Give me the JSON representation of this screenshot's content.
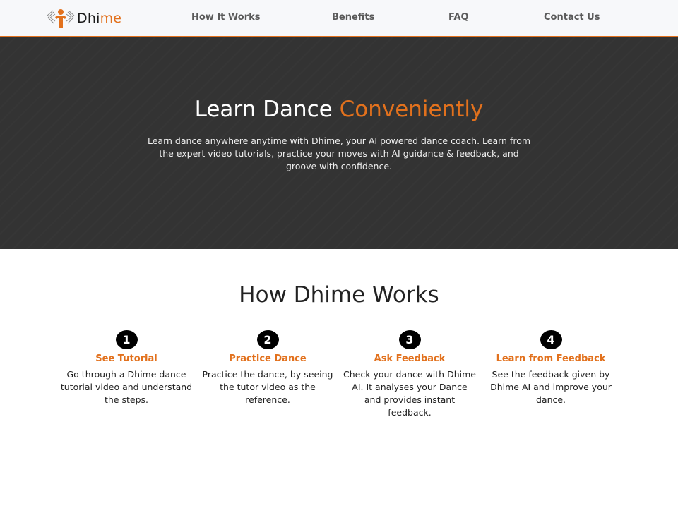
{
  "brand": {
    "name_part1": "Dhi",
    "name_part2": "me",
    "logo_icon": "dancer-logo-icon"
  },
  "nav": {
    "links": [
      "How It Works",
      "Benefits",
      "FAQ",
      "Contact Us"
    ]
  },
  "hero": {
    "title_main": "Learn Dance ",
    "title_accent": "Conveniently",
    "description": "Learn dance anywhere anytime with Dhime, your AI powered dance coach. Learn from the expert video tutorials, practice your moves with AI guidance & feedback, and groove with confidence."
  },
  "how_it_works": {
    "title": "How Dhime Works",
    "steps": [
      {
        "number": "1",
        "title": "See Tutorial",
        "description": "Go through a Dhime dance tutorial video and understand the steps."
      },
      {
        "number": "2",
        "title": "Practice Dance",
        "description": "Practice the dance, by seeing the tutor video as the reference."
      },
      {
        "number": "3",
        "title": "Ask Feedback",
        "description": "Check your dance with Dhime AI. It analyses your Dance and provides instant feedback."
      },
      {
        "number": "4",
        "title": "Learn from Feedback",
        "description": "See the feedback given by Dhime AI and improve your dance."
      }
    ]
  },
  "colors": {
    "accent": "#e2711d",
    "hero_bg": "#333333",
    "nav_bg": "#f7f8fa"
  }
}
